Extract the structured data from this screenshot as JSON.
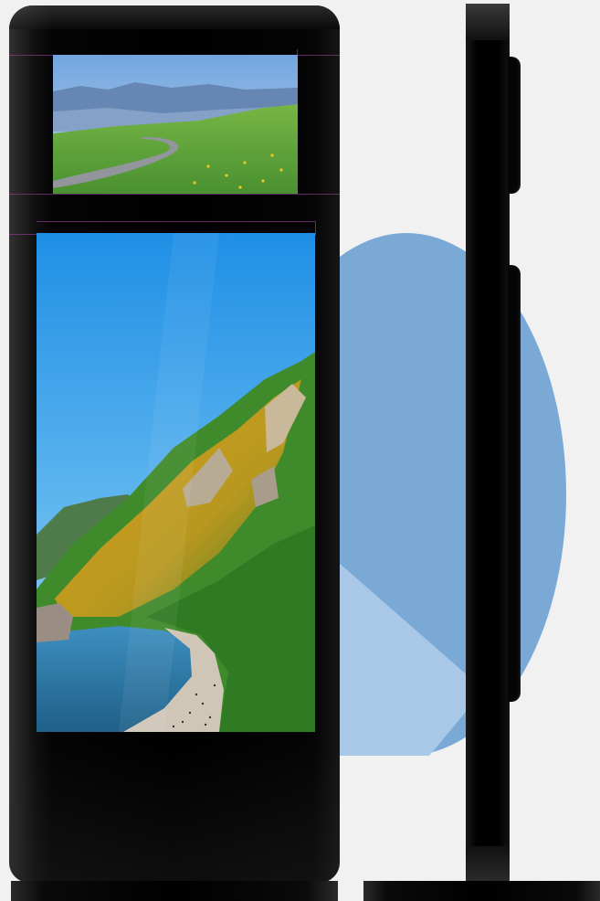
{
  "product": {
    "variant": "dual-screen-floor-standing-kiosk",
    "front_view": {
      "top_screen": {
        "image": "mountain-road-landscape"
      },
      "main_screen": {
        "image": "coastal-mountain-beach"
      }
    },
    "side_view": {
      "panels": 2
    },
    "decor": {
      "circle_color": "#7aa9d6",
      "circle_slice_color": "#a9c8e8"
    }
  },
  "colors": {
    "background": "#f1f1f2",
    "bezel": "#000000",
    "sky_top": "#1f8fe6",
    "sky_bottom": "#7cc4ef",
    "foliage": "#3f8a2a",
    "foliage_yellow": "#d8a21c",
    "sea": "#2b7aa8",
    "guide_line": "#8a3a8a"
  }
}
